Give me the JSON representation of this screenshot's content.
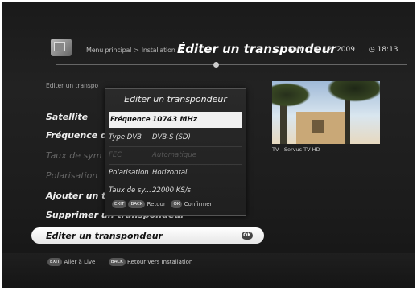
{
  "header": {
    "breadcrumb": [
      "Menu principal",
      "Installation"
    ],
    "title": "Éditer un transpondeur",
    "date": "Sam. 26. 12. 2009",
    "time": "18:13"
  },
  "list": {
    "subtitle": "Editer un transpo",
    "items": [
      {
        "label": "Satellite",
        "state": "normal"
      },
      {
        "label": "Fréquence d",
        "state": "normal"
      },
      {
        "label": "Taux de sym",
        "state": "disabled"
      },
      {
        "label": "Polarisation",
        "state": "disabled"
      },
      {
        "label": "Ajouter un t",
        "state": "normal"
      },
      {
        "label": "Supprimer un transpondeur",
        "state": "normal"
      },
      {
        "label": "Editer un transpondeur",
        "state": "selected"
      }
    ],
    "ok_badge": "OK"
  },
  "preview": {
    "caption": "TV - Servus TV HD"
  },
  "dialog": {
    "title": "Editer un transpondeur",
    "rows": [
      {
        "key": "Fréquence",
        "value": "10743 MHz",
        "state": "active"
      },
      {
        "key": "Type DVB",
        "value": "DVB-S (SD)",
        "state": "normal"
      },
      {
        "key": "FEC",
        "value": "Automatique",
        "state": "dim"
      },
      {
        "key": "Polarisation",
        "value": "Horizontal",
        "state": "normal"
      },
      {
        "key": "Taux de sy...",
        "value": "22000 KS/s",
        "state": "normal"
      }
    ],
    "footer": {
      "exit_key": "EXIT",
      "back_key": "BACK",
      "back_label": "Retour",
      "ok_key": "OK",
      "ok_label": "Confirmer"
    }
  },
  "bottom": {
    "exit_key": "EXIT",
    "exit_label": "Aller à Live",
    "back_key": "BACK",
    "back_label": "Retour vers Installation"
  }
}
